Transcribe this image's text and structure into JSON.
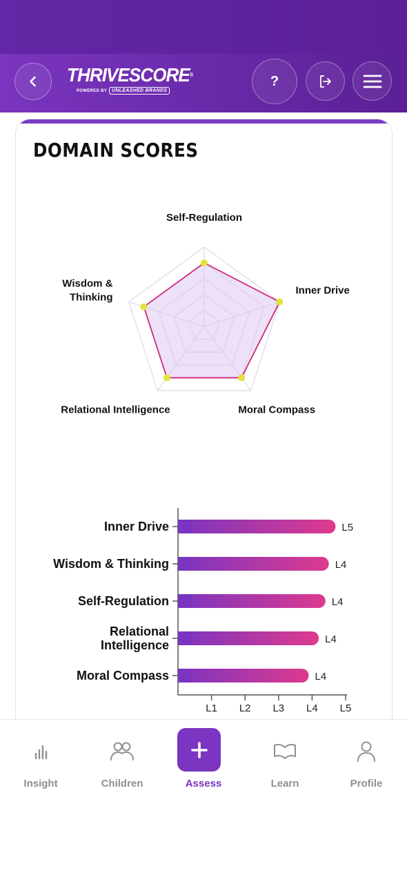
{
  "header": {
    "logo_text": "THRIVESCORE",
    "logo_reg": "®",
    "logo_powered": "POWERED BY",
    "logo_brand": "UNLEASHED BRANDS",
    "back_icon": "chevron-left-icon",
    "help_label": "?",
    "logout_icon": "logout-icon",
    "menu_icon": "hamburger-menu-icon"
  },
  "card": {
    "title": "DOMAIN SCORES"
  },
  "colors": {
    "header_purple": "#6226a6",
    "accent_purple": "#7b35c0",
    "radar_line": "#d0287a",
    "radar_fill": "#ddc8ef",
    "radar_point": "#e3e33a",
    "bar_start": "#7a35c0",
    "bar_end": "#de3a8e",
    "nav_inactive": "#8f8f95"
  },
  "chart_data": [
    {
      "type": "radar",
      "axes": [
        "Self-Regulation",
        "Inner Drive",
        "Moral Compass",
        "Relational Intelligence",
        "Wisdom & Thinking"
      ],
      "axis_label_lines": [
        [
          "Self-Regulation"
        ],
        [
          "Inner Drive"
        ],
        [
          "Moral Compass"
        ],
        [
          "Relational Intelligence"
        ],
        [
          "Wisdom &",
          "Thinking"
        ]
      ],
      "values": [
        4,
        5,
        4,
        4,
        4
      ],
      "max": 5,
      "rings": 5
    },
    {
      "type": "bar",
      "orientation": "horizontal",
      "categories": [
        "Inner Drive",
        "Wisdom & Thinking",
        "Self-Regulation",
        "Relational Intelligence",
        "Moral Compass"
      ],
      "category_lines": [
        [
          "Inner Drive"
        ],
        [
          "Wisdom & Thinking"
        ],
        [
          "Self-Regulation"
        ],
        [
          "Relational",
          "Intelligence"
        ],
        [
          "Moral Compass"
        ]
      ],
      "values": [
        4.7,
        4.5,
        4.4,
        4.2,
        3.9
      ],
      "value_labels": [
        "L5",
        "L4",
        "L4",
        "L4",
        "L4"
      ],
      "x_ticks": [
        "L1",
        "L2",
        "L3",
        "L4",
        "L5"
      ],
      "xlim": [
        0,
        5
      ]
    }
  ],
  "nav": {
    "items": [
      {
        "label": "Insight",
        "icon": "bar-chart-icon"
      },
      {
        "label": "Children",
        "icon": "people-icon"
      },
      {
        "label": "Assess",
        "icon": "plus-icon"
      },
      {
        "label": "Learn",
        "icon": "book-open-icon"
      },
      {
        "label": "Profile",
        "icon": "person-icon"
      }
    ],
    "active": "Assess"
  }
}
